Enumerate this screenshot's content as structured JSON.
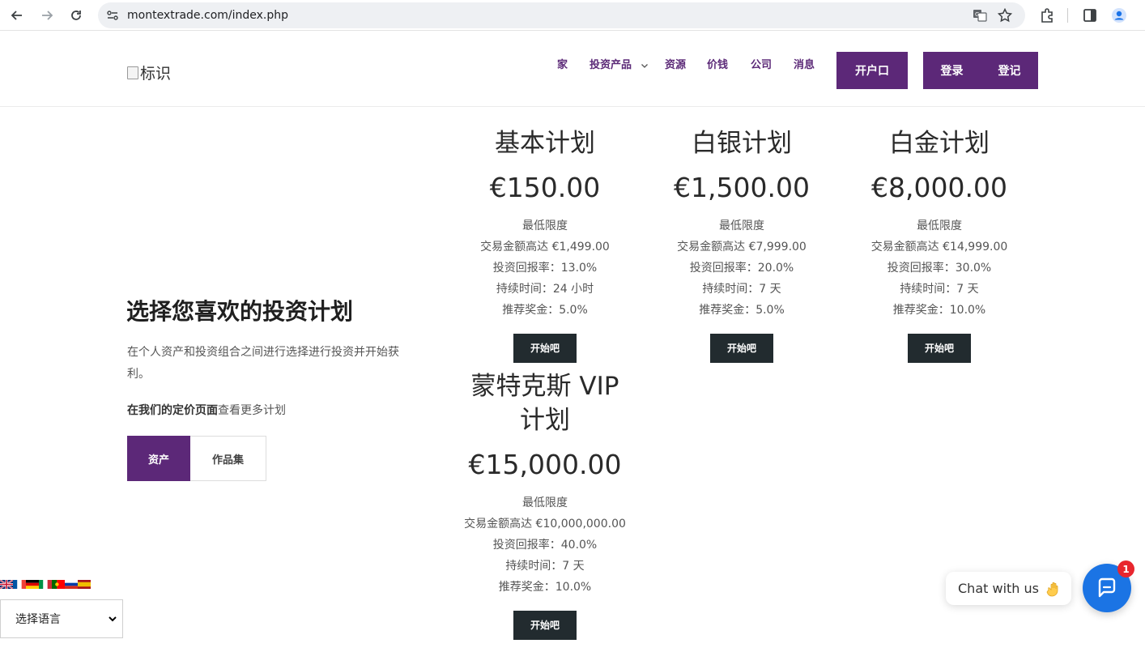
{
  "browser": {
    "url": "montextrade.com/index.php"
  },
  "header": {
    "logo_alt": "标识",
    "menu": [
      "家",
      "投资产品",
      "资源",
      "价钱",
      "公司",
      "消息"
    ],
    "open_account": "开户口",
    "login": "登录",
    "register": "登记"
  },
  "hero": {
    "title": "选择您喜欢的投资计划",
    "description": "在个人资产和投资组合之间进行选择进行投资并开始获利。",
    "more_bold": "在我们的定价页面",
    "more_rest": "查看更多计划",
    "tab_assets": "资产",
    "tab_portfolio": "作品集"
  },
  "plans": [
    {
      "name": "基本计划",
      "price": "€150.00",
      "min": "最低限度",
      "max": "交易金额高达 €1,499.00",
      "roi": "投资回报率：13.0%",
      "duration": "持续时间：24 小时",
      "bonus": "推荐奖金：5.0%",
      "button": "开始吧"
    },
    {
      "name": "白银计划",
      "price": "€1,500.00",
      "min": "最低限度",
      "max": "交易金额高达 €7,999.00",
      "roi": "投资回报率：20.0%",
      "duration": "持续时间：7 天",
      "bonus": "推荐奖金：5.0%",
      "button": "开始吧"
    },
    {
      "name": "白金计划",
      "price": "€8,000.00",
      "min": "最低限度",
      "max": "交易金额高达 €14,999.00",
      "roi": "投资回报率：30.0%",
      "duration": "持续时间：7 天",
      "bonus": "推荐奖金：10.0%",
      "button": "开始吧"
    },
    {
      "name": "蒙特克斯 VIP 计划",
      "price": "€15,000.00",
      "min": "最低限度",
      "max": "交易金额高达 €10,000,000.00",
      "roi": "投资回报率：40.0%",
      "duration": "持续时间：7 天",
      "bonus": "推荐奖金：10.0%",
      "button": "开始吧"
    }
  ],
  "language": {
    "select_label": "选择语言",
    "flags": [
      "uk-flag-icon",
      "france-flag-icon",
      "germany-flag-icon",
      "italy-flag-icon",
      "portugal-flag-icon",
      "russia-flag-icon",
      "spain-flag-icon"
    ]
  },
  "chat": {
    "label": "Chat with us",
    "badge": "1"
  },
  "colors": {
    "brand_purple": "#5c2878",
    "dark_button": "#222b2f",
    "chat_blue": "#1b74e4"
  }
}
